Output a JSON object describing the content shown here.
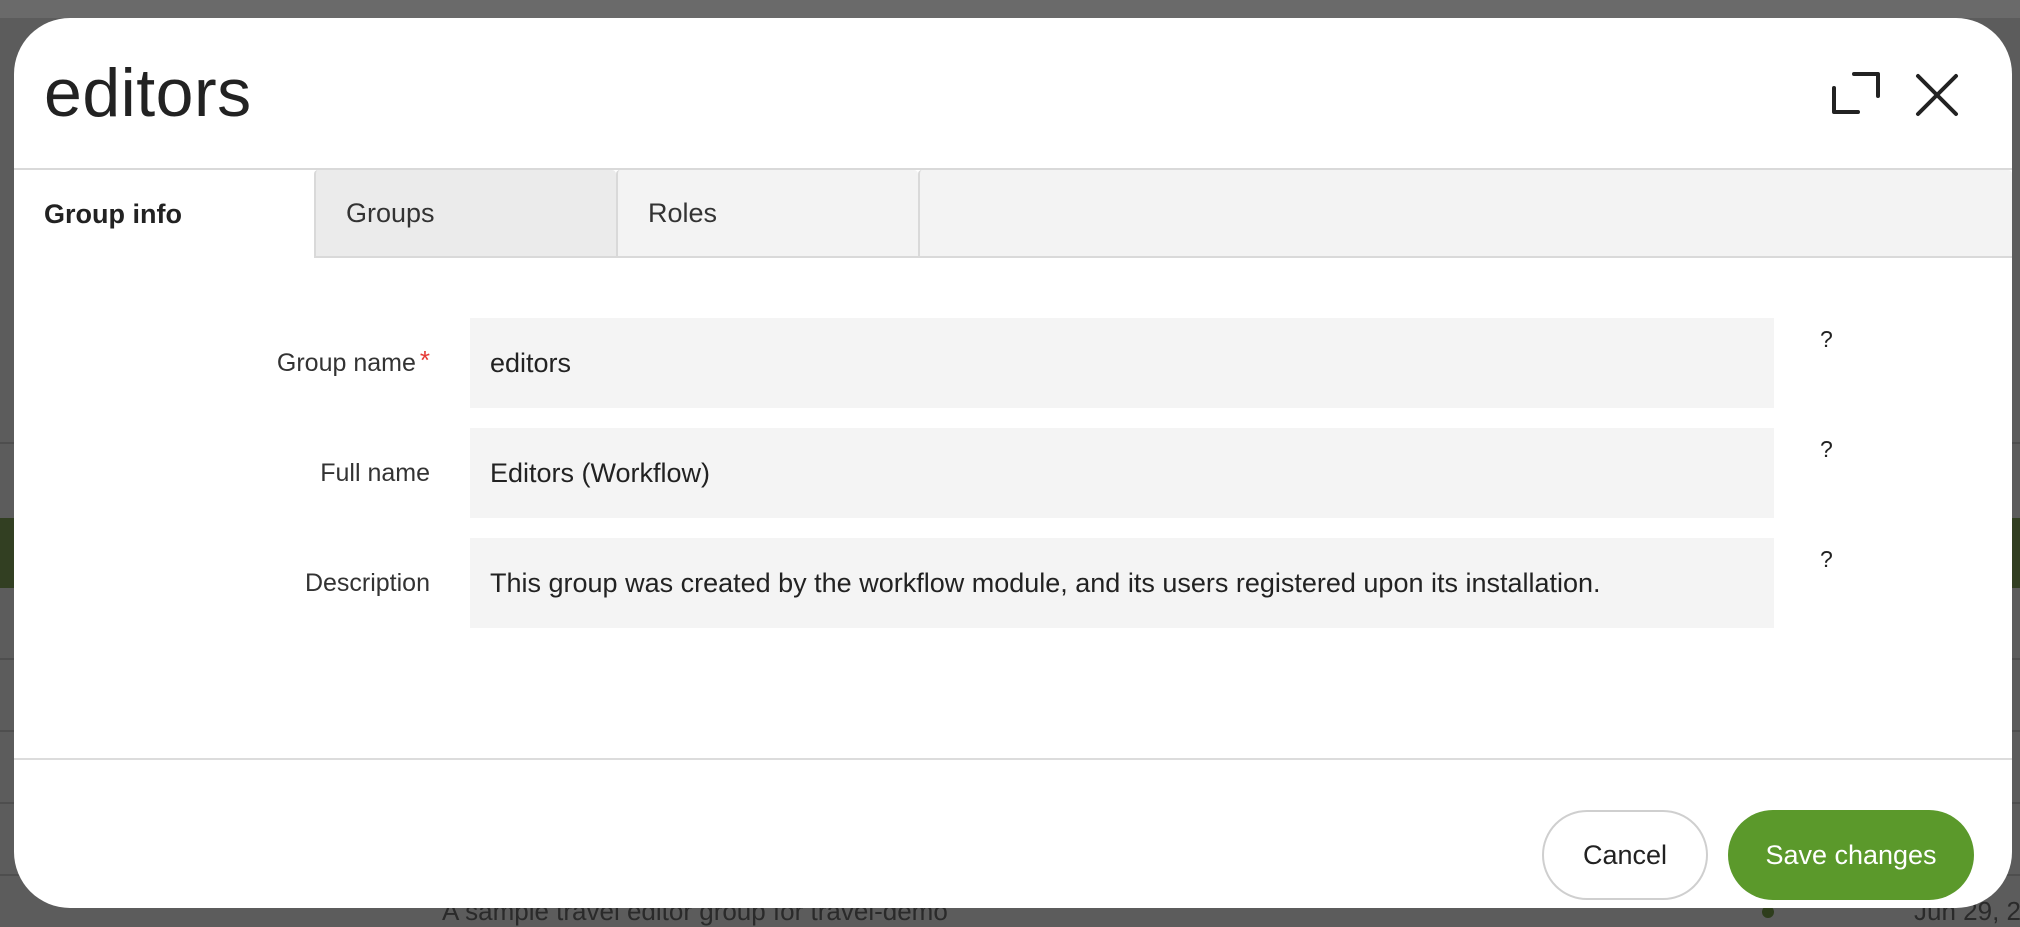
{
  "backdrop": {
    "row_text": "A sample travel editor group for travel-demo",
    "row_date": "Jun 29, 2"
  },
  "modal": {
    "title": "editors",
    "icons": {
      "expand": "expand-icon",
      "close": "close-icon"
    },
    "tabs": [
      {
        "label": "Group info",
        "active": true
      },
      {
        "label": "Groups",
        "active": false
      },
      {
        "label": "Roles",
        "active": false
      }
    ],
    "form": {
      "fields": [
        {
          "label": "Group name",
          "required": true,
          "required_mark": "*",
          "value": "editors",
          "help": "?"
        },
        {
          "label": "Full name",
          "required": false,
          "value": "Editors (Workflow)",
          "help": "?"
        },
        {
          "label": "Description",
          "required": false,
          "value": "This group was created by the workflow module, and its users registered upon its installation.",
          "help": "?"
        }
      ]
    },
    "footer": {
      "cancel_label": "Cancel",
      "save_label": "Save changes"
    },
    "colors": {
      "accent": "#5b992b",
      "required": "#e53935"
    }
  }
}
